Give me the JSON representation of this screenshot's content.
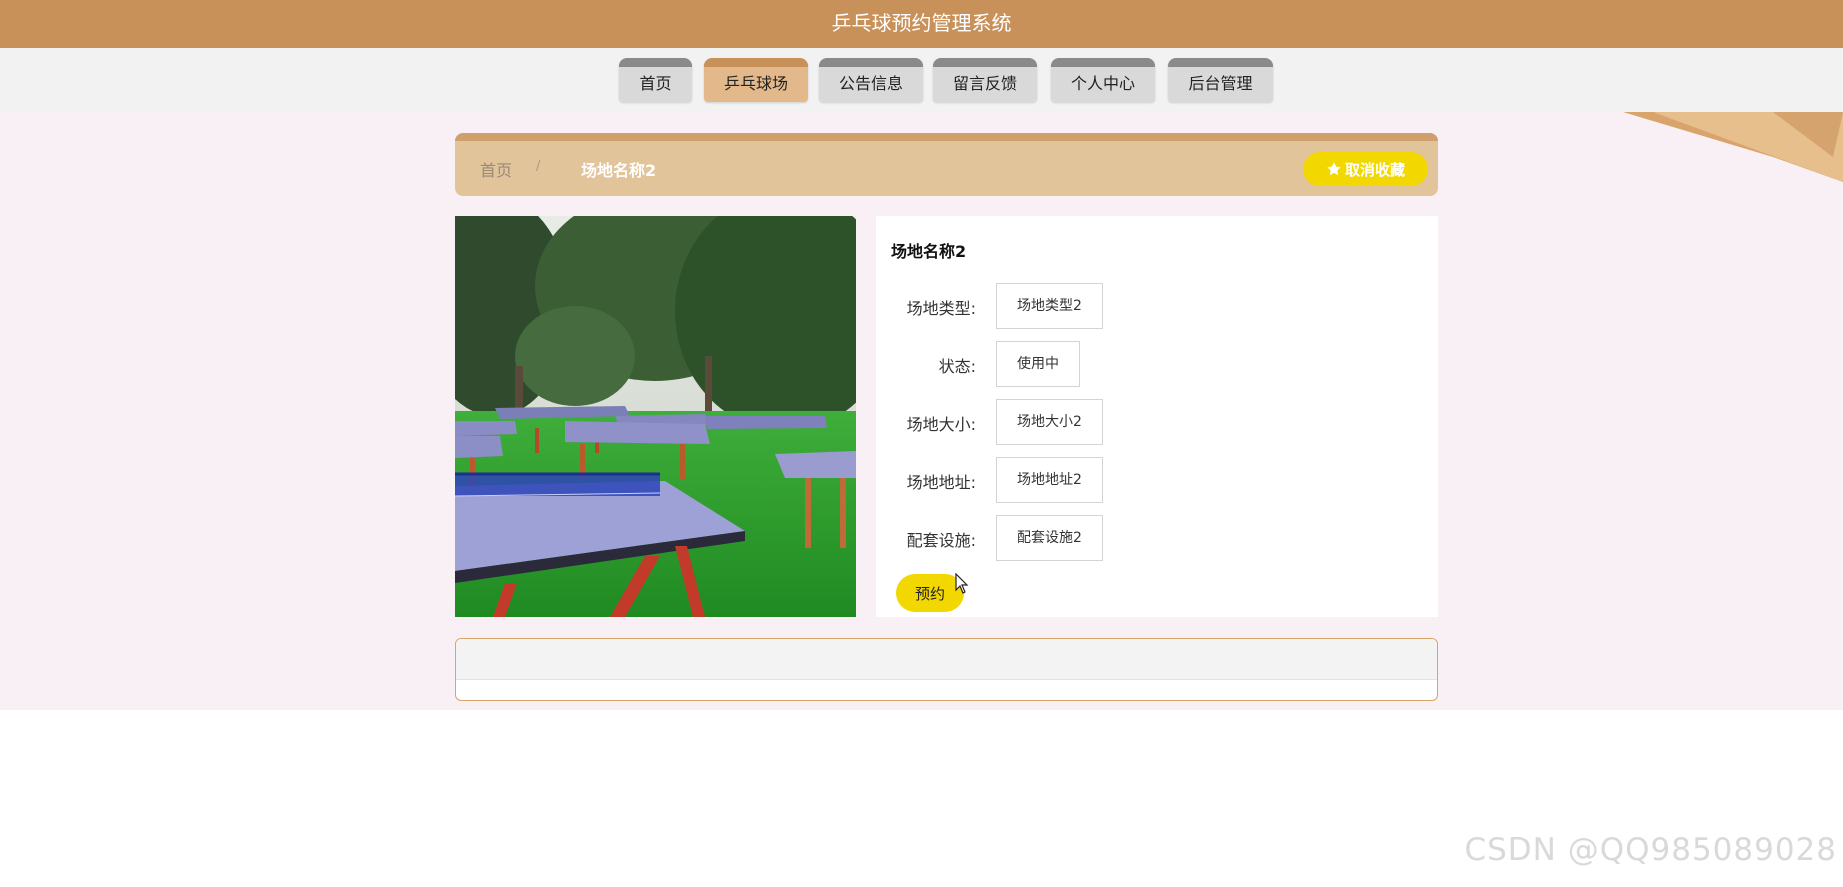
{
  "app": {
    "title": "乒乓球预约管理系统"
  },
  "nav": {
    "items": [
      {
        "label": "首页",
        "active": false
      },
      {
        "label": "乒乓球场",
        "active": true
      },
      {
        "label": "公告信息",
        "active": false
      },
      {
        "label": "留言反馈",
        "active": false
      },
      {
        "label": "个人中心",
        "active": false
      },
      {
        "label": "后台管理",
        "active": false
      }
    ]
  },
  "breadcrumb": {
    "home": "首页",
    "separator": "/",
    "current": "场地名称2"
  },
  "favorite": {
    "label": "取消收藏",
    "icon": "star-icon"
  },
  "detail": {
    "title": "场地名称2",
    "fields": [
      {
        "label": "场地类型:",
        "value": "场地类型2"
      },
      {
        "label": "状态:",
        "value": "使用中"
      },
      {
        "label": "场地大小:",
        "value": "场地大小2"
      },
      {
        "label": "场地地址:",
        "value": "场地地址2"
      },
      {
        "label": "配套设施:",
        "value": "配套设施2"
      }
    ],
    "book_label": "预约"
  },
  "watermark": "CSDN @QQ985089028",
  "colors": {
    "header": "#c8915a",
    "nav_active": "#e3b98b",
    "breadcrumb_bar": "#e2c49a",
    "accent_yellow": "#f2d800",
    "page_bg": "#f8f0f4"
  }
}
